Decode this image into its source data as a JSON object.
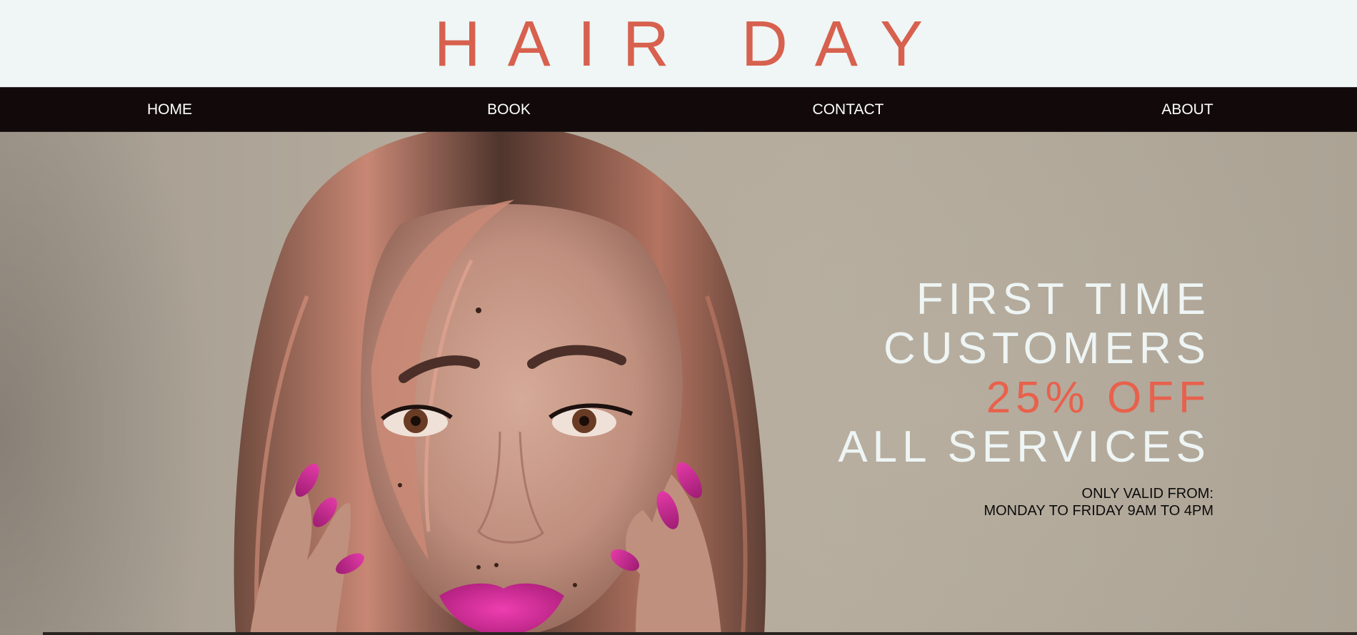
{
  "header": {
    "logo": "HAIR DAY",
    "logo_color": "#d7614e",
    "background": "#eff6f5"
  },
  "nav": {
    "items": [
      {
        "label": "HOME"
      },
      {
        "label": "BOOK"
      },
      {
        "label": "CONTACT"
      },
      {
        "label": "ABOUT"
      }
    ],
    "background": "#120a0a"
  },
  "hero": {
    "image": "portrait of a woman with auburn hair, pink nails and pink lips touching her face",
    "promo": {
      "line1": "FIRST TIME",
      "line2": "CUSTOMERS",
      "line3": "25% OFF",
      "line4": "ALL SERVICES",
      "accent_color": "#e8614c",
      "text_color": "#eef5f4"
    },
    "validity": {
      "line1": "ONLY VALID FROM:",
      "line2": "MONDAY TO FRIDAY 9AM TO 4PM"
    }
  }
}
